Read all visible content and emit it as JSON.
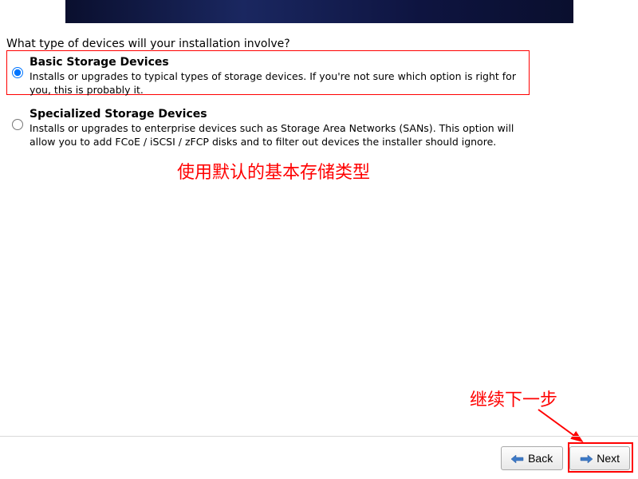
{
  "prompt": "What type of devices will your installation involve?",
  "options": [
    {
      "title": "Basic Storage Devices",
      "desc": "Installs or upgrades to typical types of storage devices.  If you're not sure which option is right for you, this is probably it."
    },
    {
      "title": "Specialized Storage Devices",
      "desc": "Installs or upgrades to enterprise devices such as Storage Area Networks (SANs). This option will allow you to add FCoE / iSCSI / zFCP disks and to filter out devices the installer should ignore."
    }
  ],
  "annotations": {
    "useDefault": "使用默认的基本存储类型",
    "continue": "继续下一步"
  },
  "buttons": {
    "back": "Back",
    "next": "Next"
  }
}
